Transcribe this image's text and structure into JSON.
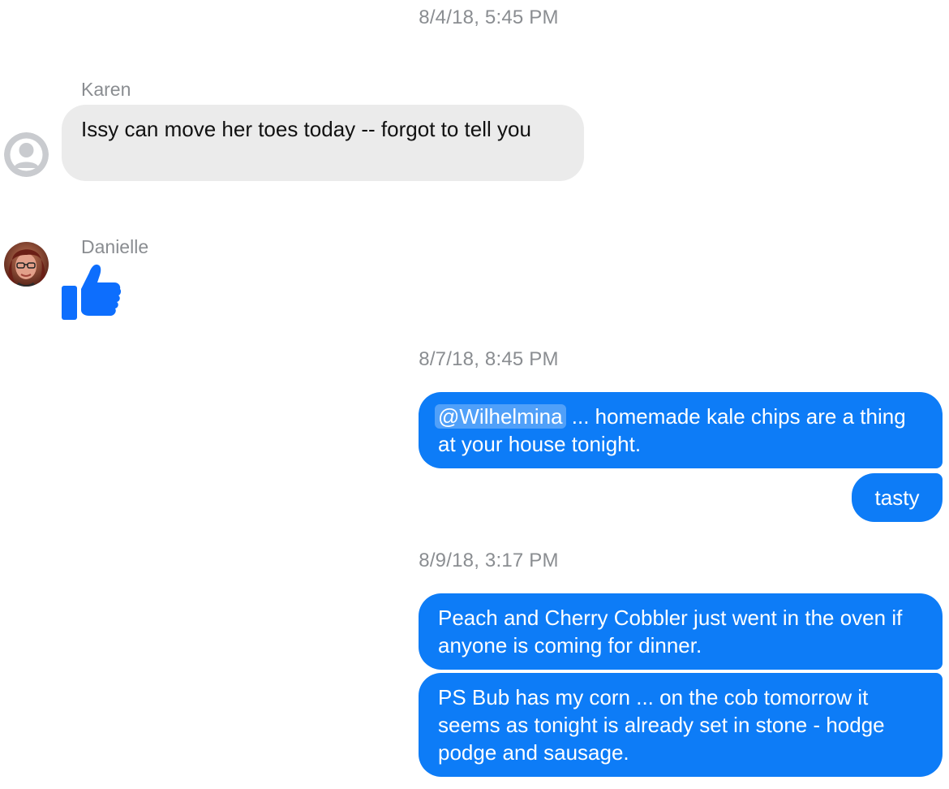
{
  "conversation": {
    "groups": [
      {
        "timestamp": "8/4/18, 5:45 PM"
      },
      {
        "timestamp": "8/7/18, 8:45 PM"
      },
      {
        "timestamp": "8/9/18, 3:17 PM"
      }
    ],
    "incoming": {
      "karen": {
        "name": "Karen",
        "message": "Issy can move her toes today -- forgot to tell you"
      },
      "danielle": {
        "name": "Danielle",
        "reaction": "thumbs-up-like-icon"
      }
    },
    "outgoing": [
      {
        "mention": "@Wilhelmina",
        "text": " ... homemade kale chips are a thing at your house tonight."
      },
      {
        "text": "tasty"
      },
      {
        "text": "Peach and Cherry Cobbler just went in the oven if anyone is coming for dinner."
      },
      {
        "text": "PS Bub has my corn ... on the cob tomorrow it seems as tonight is already set in stone - hodge podge and sausage."
      }
    ]
  },
  "colors": {
    "outgoing_bubble": "#0d7cf7",
    "incoming_bubble": "#ebebeb",
    "meta_text": "#8a8d91",
    "like_icon": "#0d6efd"
  }
}
